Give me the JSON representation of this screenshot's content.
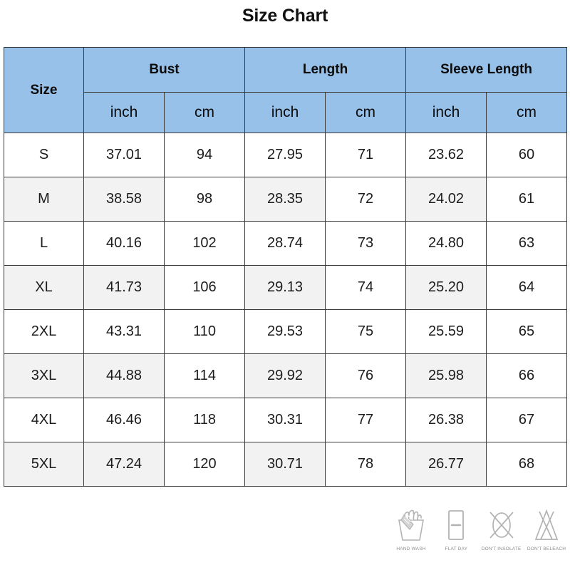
{
  "title": "Size Chart",
  "table": {
    "size_header": "Size",
    "groups": [
      {
        "label": "Bust",
        "units": [
          "inch",
          "cm"
        ]
      },
      {
        "label": "Length",
        "units": [
          "inch",
          "cm"
        ]
      },
      {
        "label": "Sleeve Length",
        "units": [
          "inch",
          "cm"
        ]
      }
    ],
    "rows": [
      {
        "size": "S",
        "bust_inch": "37.01",
        "bust_cm": "94",
        "length_inch": "27.95",
        "length_cm": "71",
        "sleeve_inch": "23.62",
        "sleeve_cm": "60"
      },
      {
        "size": "M",
        "bust_inch": "38.58",
        "bust_cm": "98",
        "length_inch": "28.35",
        "length_cm": "72",
        "sleeve_inch": "24.02",
        "sleeve_cm": "61"
      },
      {
        "size": "L",
        "bust_inch": "40.16",
        "bust_cm": "102",
        "length_inch": "28.74",
        "length_cm": "73",
        "sleeve_inch": "24.80",
        "sleeve_cm": "63"
      },
      {
        "size": "XL",
        "bust_inch": "41.73",
        "bust_cm": "106",
        "length_inch": "29.13",
        "length_cm": "74",
        "sleeve_inch": "25.20",
        "sleeve_cm": "64"
      },
      {
        "size": "2XL",
        "bust_inch": "43.31",
        "bust_cm": "110",
        "length_inch": "29.53",
        "length_cm": "75",
        "sleeve_inch": "25.59",
        "sleeve_cm": "65"
      },
      {
        "size": "3XL",
        "bust_inch": "44.88",
        "bust_cm": "114",
        "length_inch": "29.92",
        "length_cm": "76",
        "sleeve_inch": "25.98",
        "sleeve_cm": "66"
      },
      {
        "size": "4XL",
        "bust_inch": "46.46",
        "bust_cm": "118",
        "length_inch": "30.31",
        "length_cm": "77",
        "sleeve_inch": "26.38",
        "sleeve_cm": "67"
      },
      {
        "size": "5XL",
        "bust_inch": "47.24",
        "bust_cm": "120",
        "length_inch": "30.71",
        "length_cm": "78",
        "sleeve_inch": "26.77",
        "sleeve_cm": "68"
      }
    ]
  },
  "care_symbols": [
    {
      "icon": "hand-wash-icon",
      "label": "HAND WASH"
    },
    {
      "icon": "flat-dry-icon",
      "label": "FLAT DAY"
    },
    {
      "icon": "do-not-insolate-icon",
      "label": "DON'T INSOLATE"
    },
    {
      "icon": "do-not-bleach-icon",
      "label": "DON'T BELEACH"
    }
  ],
  "colors": {
    "header_blue": "#97c1e8",
    "row_shade": "#f2f2f2",
    "border": "#3a3a3a",
    "care_gray": "#8c8c8c"
  }
}
